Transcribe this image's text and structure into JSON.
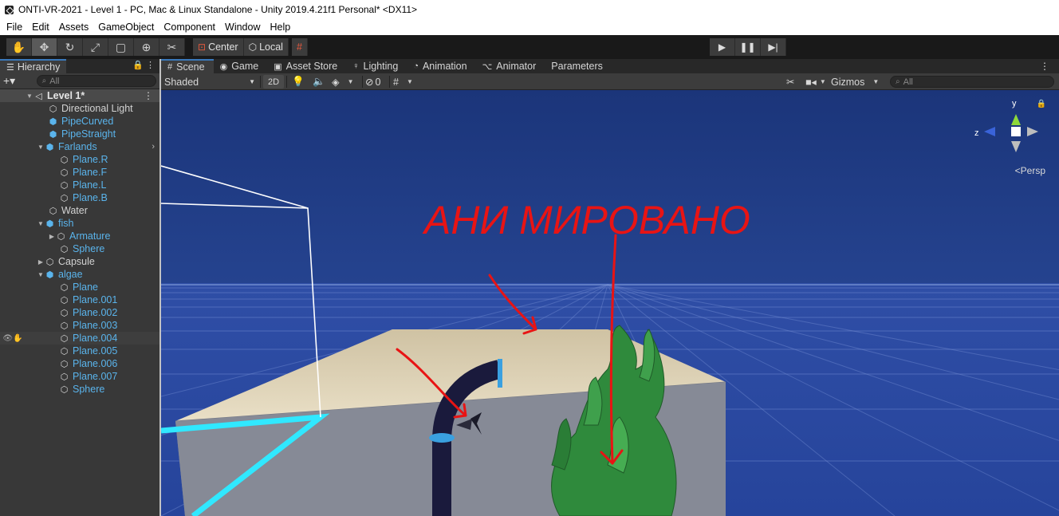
{
  "window": {
    "title": "ONTI-VR-2021 - Level 1 - PC, Mac & Linux Standalone - Unity 2019.4.21f1 Personal* <DX11>"
  },
  "menu": [
    "File",
    "Edit",
    "Assets",
    "GameObject",
    "Component",
    "Window",
    "Help"
  ],
  "toolbar": {
    "tools": [
      "hand-tool-icon",
      "move-tool-icon",
      "rotate-tool-icon",
      "scale-tool-icon",
      "rect-tool-icon",
      "transform-tool-icon",
      "custom-tool-icon"
    ],
    "pivot_label": "Center",
    "space_label": "Local"
  },
  "hierarchy": {
    "tab_label": "Hierarchy",
    "search_placeholder": "All",
    "scene_name": "Level 1*",
    "items": [
      {
        "label": "Directional Light",
        "color": "white"
      },
      {
        "label": "PipeCurved",
        "color": "blue"
      },
      {
        "label": "PipeStraight",
        "color": "blue"
      },
      {
        "label": "Farlands",
        "color": "blue"
      },
      {
        "label": "Plane.R",
        "color": "blue"
      },
      {
        "label": "Plane.F",
        "color": "blue"
      },
      {
        "label": "Plane.L",
        "color": "blue"
      },
      {
        "label": "Plane.B",
        "color": "blue"
      },
      {
        "label": "Water",
        "color": "white"
      },
      {
        "label": "fish",
        "color": "blue"
      },
      {
        "label": "Armature",
        "color": "blue"
      },
      {
        "label": "Sphere",
        "color": "blue"
      },
      {
        "label": "Capsule",
        "color": "white"
      },
      {
        "label": "algae",
        "color": "blue"
      },
      {
        "label": "Plane",
        "color": "blue"
      },
      {
        "label": "Plane.001",
        "color": "blue"
      },
      {
        "label": "Plane.002",
        "color": "blue"
      },
      {
        "label": "Plane.003",
        "color": "blue"
      },
      {
        "label": "Plane.004",
        "color": "blue"
      },
      {
        "label": "Plane.005",
        "color": "blue"
      },
      {
        "label": "Plane.006",
        "color": "blue"
      },
      {
        "label": "Plane.007",
        "color": "blue"
      },
      {
        "label": "Sphere",
        "color": "blue"
      }
    ]
  },
  "scene_tabs": [
    "Scene",
    "Game",
    "Asset Store",
    "Lighting",
    "Animation",
    "Animator",
    "Parameters"
  ],
  "scene_toolbar": {
    "shading_mode": "Shaded",
    "mode_2d": "2D",
    "hidden_count": "0",
    "gizmos_label": "Gizmos",
    "search_placeholder": "All"
  },
  "viewport": {
    "annotation_text": "АНИ МИРОВАНО",
    "persp_label": "<Persp",
    "gizmo_axes": {
      "y": "y",
      "z": "z"
    },
    "colors": {
      "sky": "#1f3a80",
      "floor": "#2b4aa0",
      "annotation": "#e81414",
      "water_edge": "#30e8ff",
      "algae": "#2f8a3c"
    }
  }
}
